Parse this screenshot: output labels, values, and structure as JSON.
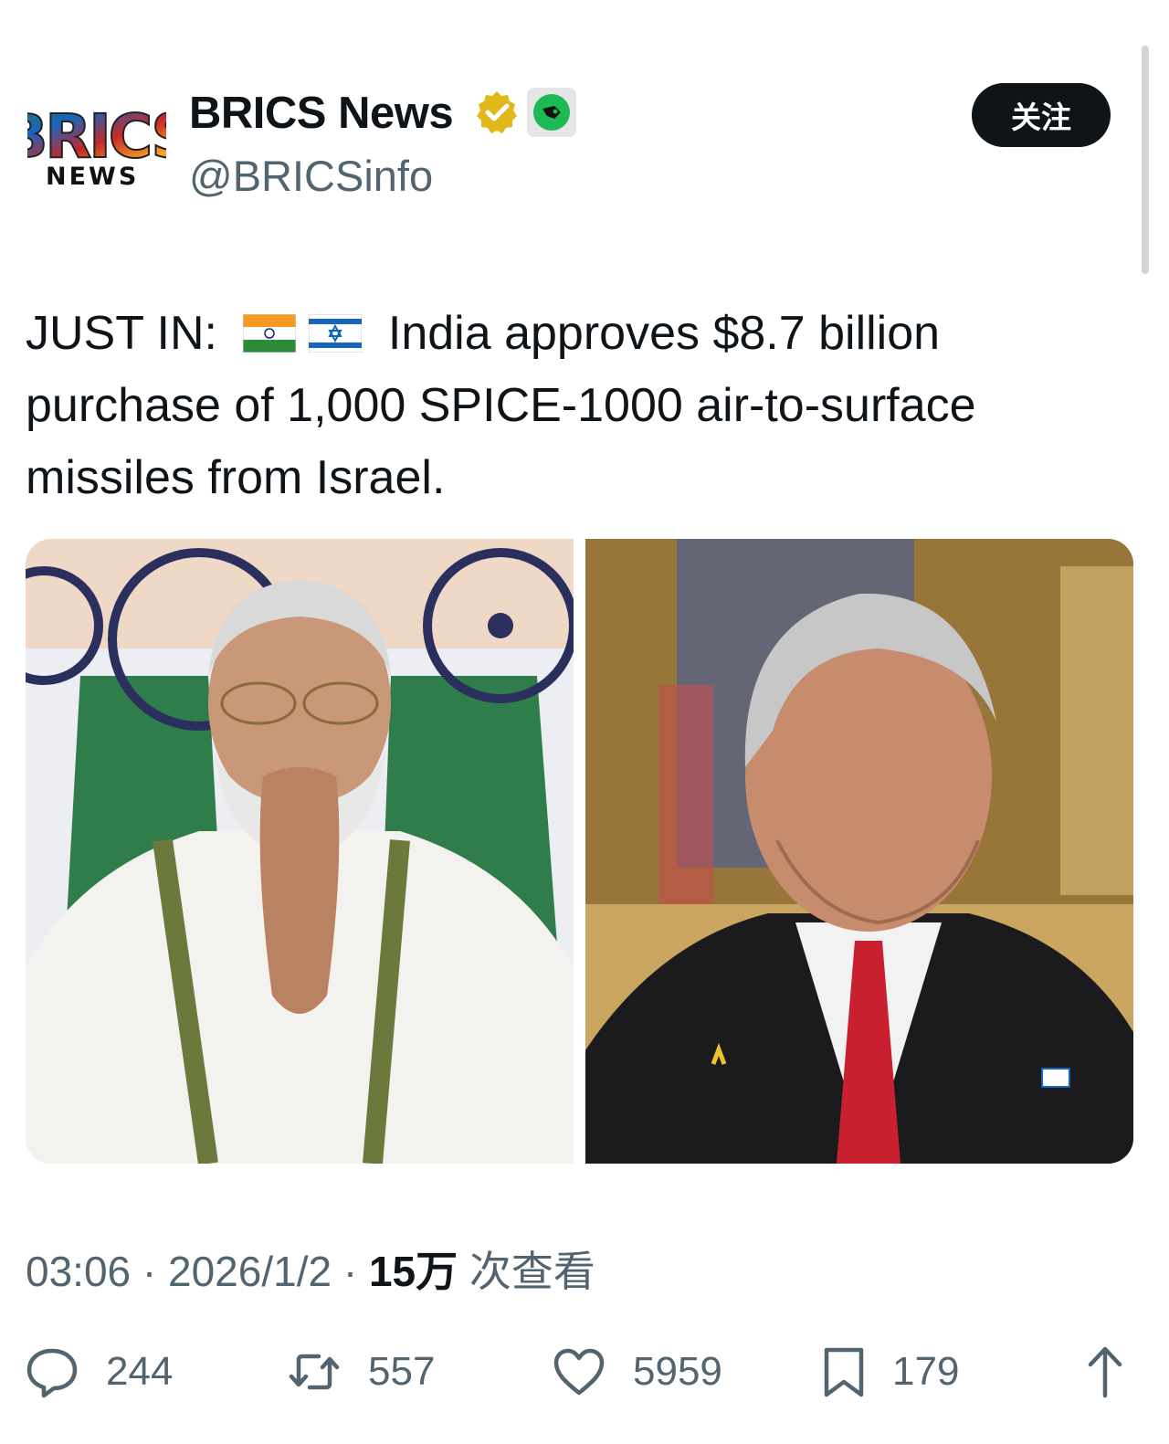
{
  "account": {
    "logo_top": "BRICS",
    "logo_bottom": "NEWS",
    "name": "BRICS News",
    "handle": "@BRICSinfo",
    "verified_icon": "gold-verified-badge",
    "affiliate_icon": "affiliate-badge"
  },
  "follow_button": {
    "label": "关注"
  },
  "tweet": {
    "prefix": "JUST IN:",
    "flags": [
      "flag-india",
      "flag-israel"
    ],
    "line1_rest": "India approves $8.7 billion",
    "line2": "purchase of 1,000 SPICE-1000 air-to-surface",
    "line3": "missiles from Israel."
  },
  "media": [
    {
      "name": "photo-indian-leader"
    },
    {
      "name": "photo-israeli-leader"
    }
  ],
  "meta": {
    "time": "03:06",
    "sep": "·",
    "date": "2026/1/2",
    "views": "15万",
    "views_label": "次查看"
  },
  "actions": {
    "replies": "244",
    "reposts": "557",
    "likes": "5959",
    "bookmarks": "179"
  },
  "colors": {
    "text": "#0f1419",
    "secondary": "#536471",
    "follow_bg": "#0f1419",
    "verified_gold": "#e2b719"
  }
}
